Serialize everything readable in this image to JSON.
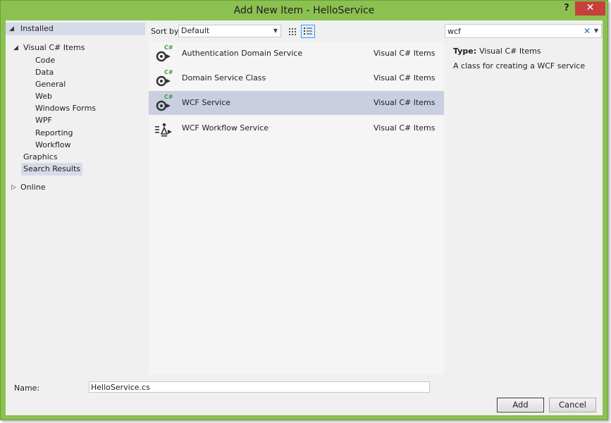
{
  "window": {
    "title": "Add New Item - HelloService",
    "help_glyph": "?",
    "close_glyph": "✕"
  },
  "tree": {
    "installed": "Installed",
    "visual_csharp": "Visual C# Items",
    "children": [
      "Code",
      "Data",
      "General",
      "Web",
      "Windows Forms",
      "WPF",
      "Reporting",
      "Workflow"
    ],
    "graphics": "Graphics",
    "search_results": "Search Results",
    "online": "Online"
  },
  "toolbar": {
    "sort_label": "Sort by:",
    "sort_value": "Default"
  },
  "templates": [
    {
      "name": "Authentication Domain Service",
      "type": "Visual C# Items",
      "icon": "csharp-service-icon"
    },
    {
      "name": "Domain Service Class",
      "type": "Visual C# Items",
      "icon": "csharp-service-icon"
    },
    {
      "name": "WCF Service",
      "type": "Visual C# Items",
      "icon": "csharp-service-icon",
      "selected": true
    },
    {
      "name": "WCF Workflow Service",
      "type": "Visual C# Items",
      "icon": "workflow-service-icon"
    }
  ],
  "search": {
    "value": "wcf",
    "clear_glyph": "✕"
  },
  "details": {
    "type_label": "Type:",
    "type_value": "Visual C# Items",
    "description": "A class for creating a WCF service"
  },
  "bottom": {
    "name_label": "Name:",
    "name_value": "HelloService.cs",
    "add_label": "Add",
    "cancel_label": "Cancel"
  },
  "colors": {
    "title_bar": "#8cc152",
    "close_button": "#c7403a",
    "selection": "#c9cfe0",
    "csharp_badge": "#3c9a3c"
  }
}
